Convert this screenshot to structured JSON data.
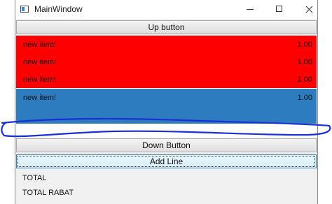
{
  "window": {
    "title": "MainWindow"
  },
  "titlebar": {
    "minimize_icon": "minimize-icon",
    "maximize_icon": "maximize-icon",
    "close_icon": "close-icon"
  },
  "buttons": {
    "up_label": "Up button",
    "down_label": "Down Button",
    "add_label": "Add Line"
  },
  "list": {
    "items": [
      {
        "name": "new item!",
        "value": "1.00",
        "color": "#ff0000"
      },
      {
        "name": "new item!",
        "value": "1.00",
        "color": "#ff0000"
      },
      {
        "name": "new item!",
        "value": "1.00",
        "color": "#ff0000"
      },
      {
        "name": "new item!",
        "value": "1.00",
        "color": "#2c7cbf"
      }
    ]
  },
  "totals": {
    "total_label": "TOTAL",
    "total_rabat_label": "TOTAL RABAT"
  },
  "annotation": {
    "stroke_color": "#1a2fd6"
  }
}
